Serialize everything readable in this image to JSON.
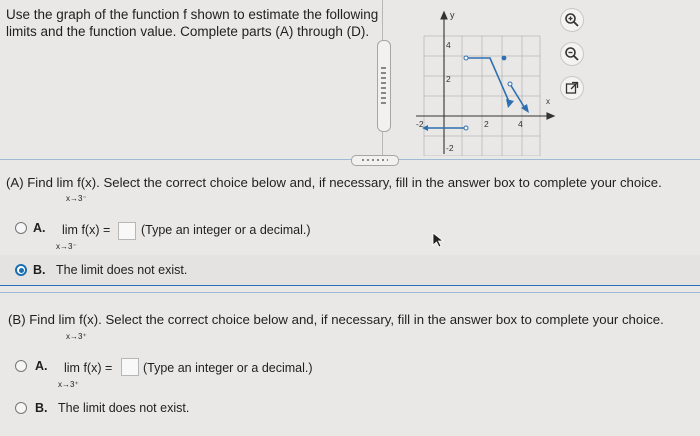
{
  "question": {
    "text": "Use the graph of the function f shown to estimate the following\nlimits and the function value. Complete parts (A) through (D)."
  },
  "graph": {
    "y_axis_label": "y",
    "x_axis_label": "x",
    "tick_labels": {
      "y_top": "4",
      "y_mid": "2",
      "y_bottom": "-2",
      "x_left": "-2",
      "x_mid": "2",
      "x_right": "4"
    }
  },
  "tools": [
    "zoom-in-icon",
    "zoom-out-icon",
    "external-link-icon"
  ],
  "part_a": {
    "prompt": "(A) Find  lim  f(x). Select the correct choice below and, if necessary, fill in the answer box to complete your choice.",
    "lim_sub": "x→3⁻",
    "option_a_letter": "A.",
    "option_a_lim": "lim  f(x) =",
    "option_a_sub": "x→3⁻",
    "option_a_hint": "(Type an integer or a decimal.)",
    "option_b_letter": "B.",
    "option_b_text": "The limit does not exist.",
    "selected": "B"
  },
  "part_b": {
    "prompt": "(B) Find  lim  f(x). Select the correct choice below and, if necessary, fill in the answer box to complete your choice.",
    "lim_sub": "x→3⁺",
    "option_a_letter": "A.",
    "option_a_lim": "lim  f(x) =",
    "option_a_sub": "x→3⁺",
    "option_a_hint": "(Type an integer or a decimal.)",
    "option_b_letter": "B.",
    "option_b_text": "The limit does not exist.",
    "selected": null
  },
  "colors": {
    "accent": "#1a6fb4",
    "graph_line": "#2d6fb0",
    "background": "#e9e8e6"
  }
}
